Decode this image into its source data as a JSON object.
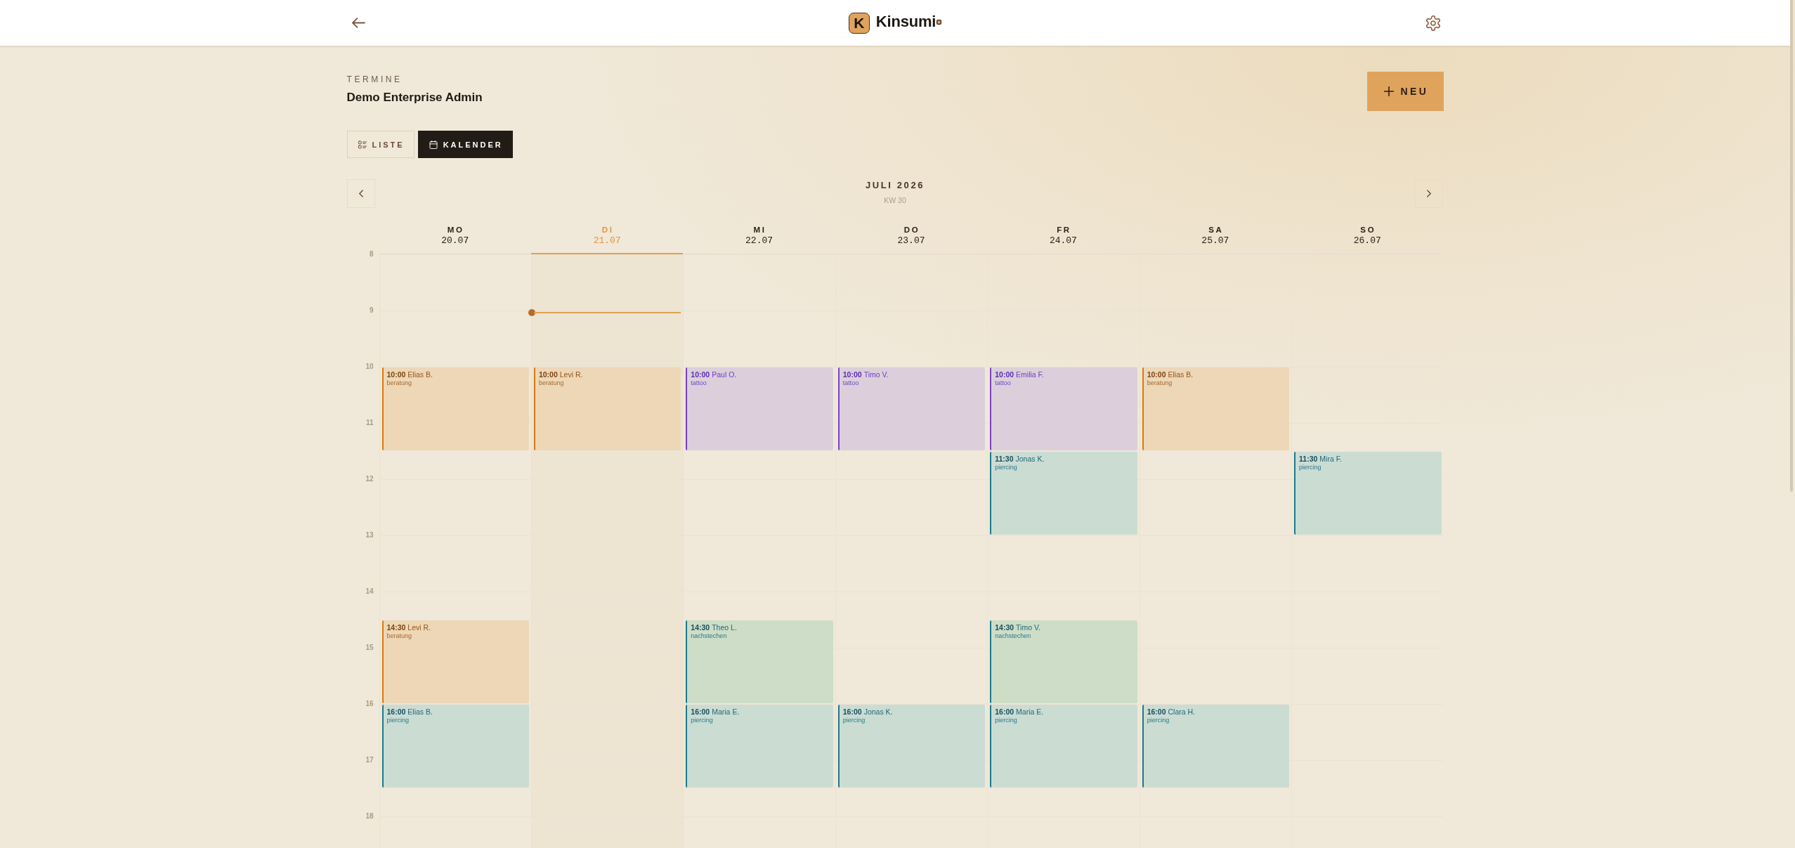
{
  "header": {
    "logo_mark": "K",
    "brand": "Kinsumi"
  },
  "page": {
    "section": "TERMINE",
    "title": "Demo Enterprise Admin",
    "new_button": "NEU"
  },
  "view_tabs": [
    {
      "label": "LISTE",
      "kind": "list",
      "selected": false
    },
    {
      "label": "KALENDER",
      "kind": "calendar",
      "selected": true
    }
  ],
  "calendar": {
    "month": "JULI 2026",
    "week": "KW 30",
    "hours": [
      "8",
      "9",
      "10",
      "11",
      "12",
      "13",
      "14",
      "15",
      "16",
      "17",
      "18"
    ],
    "days": [
      {
        "name": "MO",
        "date": "20.07",
        "selected": false,
        "events": [
          {
            "time": "10:00",
            "client": "Elias B.",
            "service": "beratung",
            "kind": "consult"
          },
          {
            "time": "14:30",
            "client": "Levi R.",
            "service": "beratung",
            "kind": "consult"
          },
          {
            "time": "16:00",
            "client": "Elias B.",
            "service": "piercing",
            "kind": "piercing"
          }
        ]
      },
      {
        "name": "DI",
        "date": "21.07",
        "selected": true,
        "events": [
          {
            "time": "10:00",
            "client": "Levi R.",
            "service": "beratung",
            "kind": "consult"
          }
        ]
      },
      {
        "name": "MI",
        "date": "22.07",
        "selected": false,
        "events": [
          {
            "time": "10:00",
            "client": "Paul O.",
            "service": "tattoo",
            "kind": "tattoo"
          },
          {
            "time": "14:30",
            "client": "Theo L.",
            "service": "nachstechen",
            "kind": "touchup"
          },
          {
            "time": "16:00",
            "client": "Maria E.",
            "service": "piercing",
            "kind": "piercing"
          }
        ]
      },
      {
        "name": "DO",
        "date": "23.07",
        "selected": false,
        "events": [
          {
            "time": "10:00",
            "client": "Timo V.",
            "service": "tattoo",
            "kind": "tattoo"
          },
          {
            "time": "16:00",
            "client": "Jonas K.",
            "service": "piercing",
            "kind": "piercing"
          }
        ]
      },
      {
        "name": "FR",
        "date": "24.07",
        "selected": false,
        "events": [
          {
            "time": "10:00",
            "client": "Emilia F.",
            "service": "tattoo",
            "kind": "tattoo"
          },
          {
            "time": "11:30",
            "client": "Jonas K.",
            "service": "piercing",
            "kind": "piercing"
          },
          {
            "time": "14:30",
            "client": "Timo V.",
            "service": "nachstechen",
            "kind": "touchup"
          },
          {
            "time": "16:00",
            "client": "Maria E.",
            "service": "piercing",
            "kind": "piercing"
          }
        ]
      },
      {
        "name": "SA",
        "date": "25.07",
        "selected": false,
        "events": [
          {
            "time": "10:00",
            "client": "Elias B.",
            "service": "beratung",
            "kind": "consult"
          },
          {
            "time": "16:00",
            "client": "Clara H.",
            "service": "piercing",
            "kind": "piercing"
          }
        ]
      },
      {
        "name": "SO",
        "date": "26.07",
        "selected": false,
        "events": [
          {
            "time": "11:30",
            "client": "Mira F.",
            "service": "piercing",
            "kind": "piercing"
          }
        ]
      }
    ]
  }
}
